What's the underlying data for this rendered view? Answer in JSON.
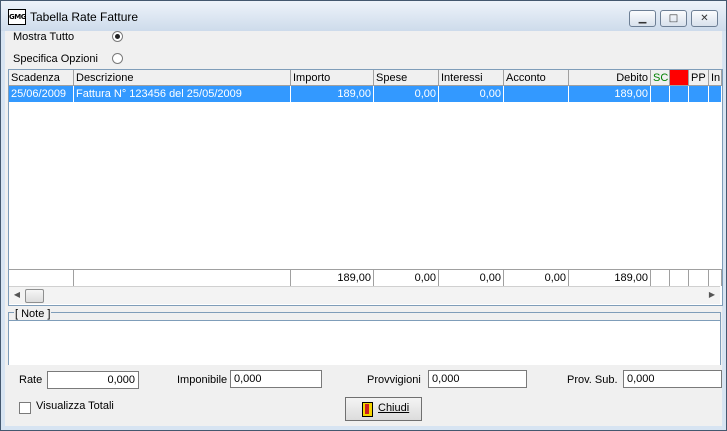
{
  "window": {
    "title": "Tabella Rate Fatture",
    "app_icon": "GMG"
  },
  "window_buttons": {
    "minimize": "▁",
    "maximize": "□",
    "close": "✕"
  },
  "options": {
    "show_all": {
      "label": "Mostra Tutto",
      "selected": true
    },
    "specify": {
      "label": "Specifica Opzioni",
      "selected": false
    }
  },
  "grid": {
    "columns": [
      "Scadenza",
      "Descrizione",
      "Importo",
      "Spese",
      "Interessi",
      "Acconto",
      "Debito",
      "SC",
      "",
      "PP",
      "In"
    ],
    "rows": [
      [
        "25/06/2009",
        "Fattura N° 123456 del 25/05/2009",
        "189,00",
        "0,00",
        "0,00",
        "",
        "189,00",
        "",
        "",
        "",
        ""
      ]
    ],
    "totals": [
      "",
      "",
      "189,00",
      "0,00",
      "0,00",
      "0,00",
      "189,00",
      "",
      "",
      "",
      ""
    ],
    "accent_colors": {
      "sc_header_text": "#008000",
      "red_header_bg": "#ff0000",
      "selection_bg": "#3399ff"
    }
  },
  "notes": {
    "label": "[ Note ]",
    "value": ""
  },
  "fields": {
    "rate": {
      "label": "Rate",
      "value": "0,000"
    },
    "imponibile": {
      "label": "Imponibile",
      "value": "0,000"
    },
    "provvigioni": {
      "label": "Provvigioni",
      "value": "0,000"
    },
    "prov_sub": {
      "label": "Prov. Sub.",
      "value": "0,000"
    }
  },
  "show_totals": {
    "label": "Visualizza Totali",
    "checked": false
  },
  "close_button": {
    "label": "Chiudi",
    "icon": "exit-door-icon"
  }
}
